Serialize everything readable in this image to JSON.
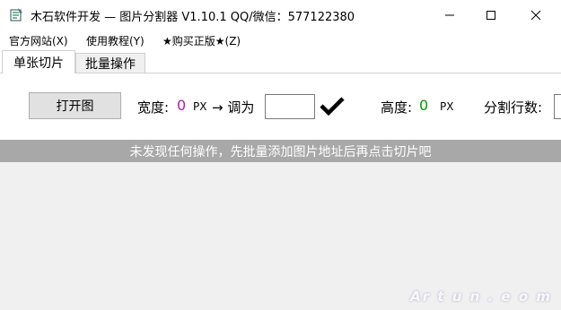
{
  "window": {
    "title": "木石软件开发 — 图片分割器 V1.10.1    QQ/微信：577122380",
    "controls": {
      "minimize": "—",
      "maximize": "☐",
      "close": "✕"
    }
  },
  "menu": {
    "items": [
      "官方网站(X)",
      "使用教程(Y)",
      "★购买正版★(Z)"
    ]
  },
  "tabs": {
    "single": "单张切片",
    "batch": "批量操作"
  },
  "toolbar": {
    "open_label": "打开图",
    "width_label": "宽度:",
    "width_value": "0",
    "px1": "PX",
    "arrow": "→ 调为",
    "height_label": "高度:",
    "height_value": "0",
    "px2": "PX",
    "rows_label": "分割行数:"
  },
  "status": {
    "message": "未发现任何操作，先批量添加图片地址后再点击切片吧"
  },
  "watermark": {
    "text": "Ar t u n . e o m"
  },
  "colors": {
    "width_value": "#b01cb0",
    "height_value": "#00a000",
    "status_bg": "#a8a8a8"
  }
}
